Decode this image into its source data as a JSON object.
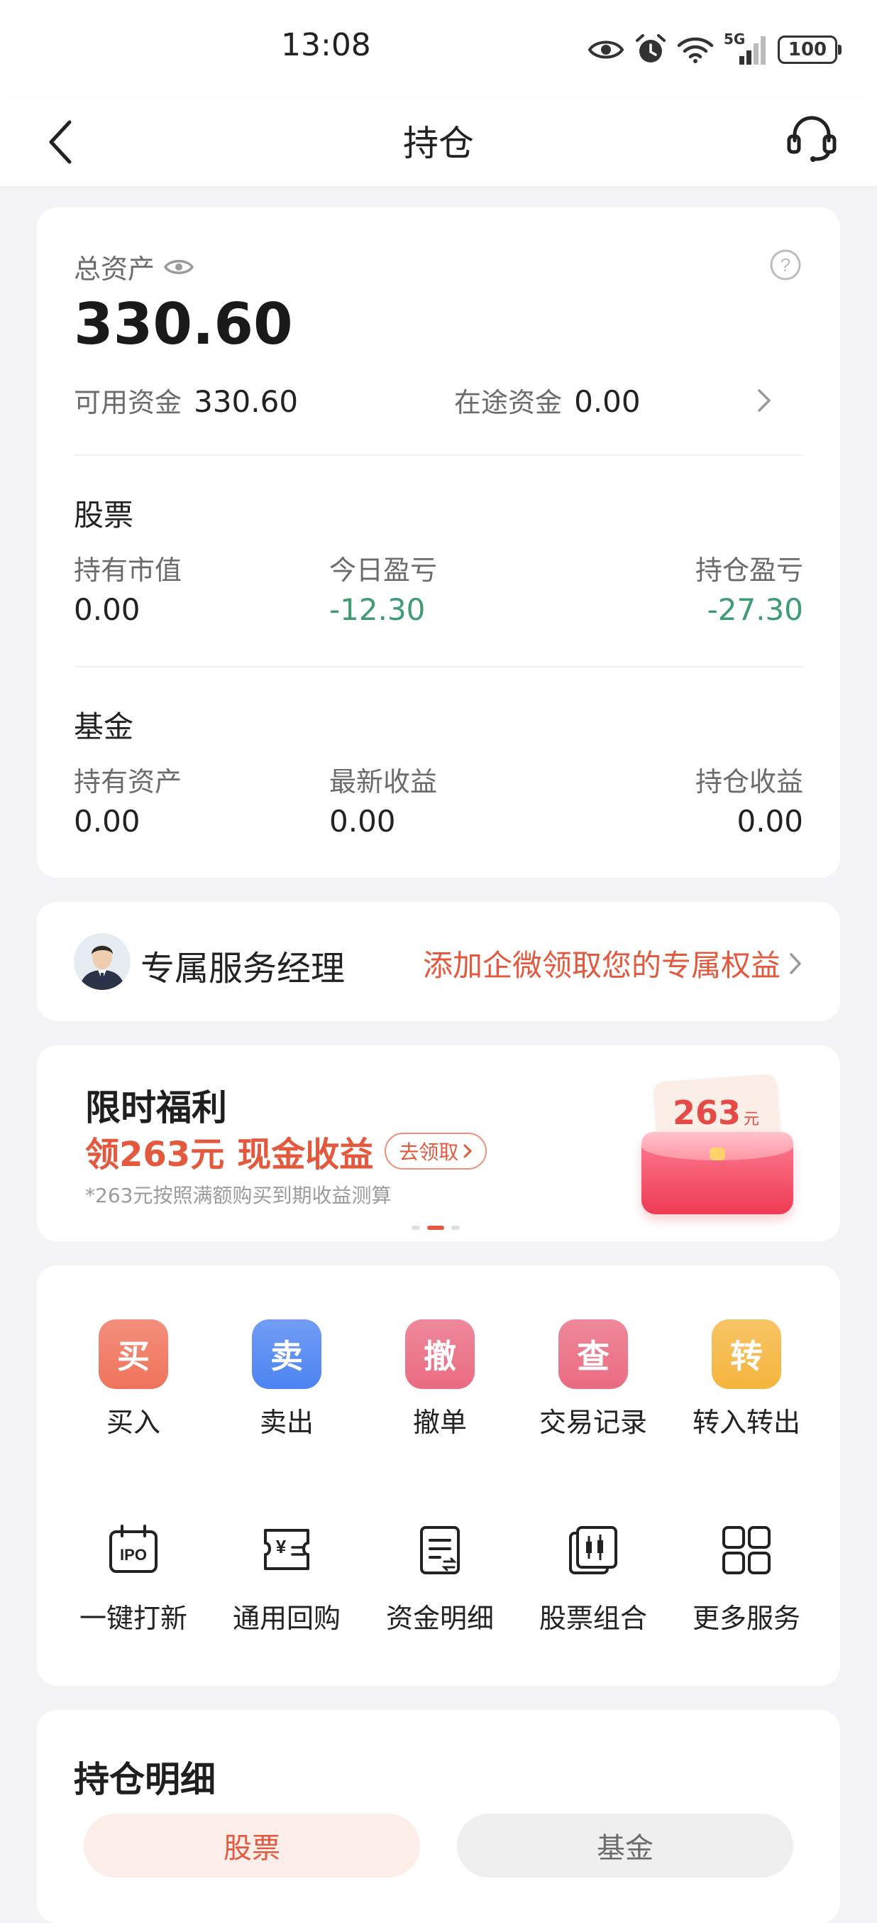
{
  "status_bar": {
    "time": "13:08",
    "network": "5G",
    "battery": "100"
  },
  "nav": {
    "title": "持仓"
  },
  "assets": {
    "total_label": "总资产",
    "total_value": "330.60",
    "available_label": "可用资金",
    "available_value": "330.60",
    "transit_label": "在途资金",
    "transit_value": "0.00",
    "stock": {
      "title": "股票",
      "market_value_label": "持有市值",
      "market_value": "0.00",
      "today_pl_label": "今日盈亏",
      "today_pl": "-12.30",
      "position_pl_label": "持仓盈亏",
      "position_pl": "-27.30"
    },
    "fund": {
      "title": "基金",
      "holding_label": "持有资产",
      "holding_value": "0.00",
      "latest_label": "最新收益",
      "latest_value": "0.00",
      "position_label": "持仓收益",
      "position_value": "0.00"
    }
  },
  "manager": {
    "title": "专属服务经理",
    "link": "添加企微领取您的专属权益"
  },
  "promo": {
    "title": "限时福利",
    "highlight_prefix": "领263元",
    "highlight_suffix": "现金收益",
    "button": "去领取",
    "note": "*263元按照满额购买到期收益测算",
    "badge_amount": "263",
    "badge_unit": "元"
  },
  "services_primary": [
    {
      "glyph": "买",
      "label": "买入",
      "color": "#f0735b"
    },
    {
      "glyph": "卖",
      "label": "卖出",
      "color": "#4d84f2"
    },
    {
      "glyph": "撤",
      "label": "撤单",
      "color": "#ea6b82"
    },
    {
      "glyph": "查",
      "label": "交易记录",
      "color": "#ea6b82"
    },
    {
      "glyph": "转",
      "label": "转入转出",
      "color": "#f5b53e"
    }
  ],
  "services_secondary": [
    {
      "label": "一键打新",
      "icon": "ipo-calendar-icon",
      "icon_text": "IPO"
    },
    {
      "label": "通用回购",
      "icon": "repo-ticket-icon",
      "icon_text": "¥"
    },
    {
      "label": "资金明细",
      "icon": "fund-detail-icon"
    },
    {
      "label": "股票组合",
      "icon": "stock-portfolio-icon"
    },
    {
      "label": "更多服务",
      "icon": "grid-icon"
    }
  ],
  "holdings": {
    "title": "持仓明细",
    "tab_stock": "股票",
    "tab_fund": "基金"
  }
}
